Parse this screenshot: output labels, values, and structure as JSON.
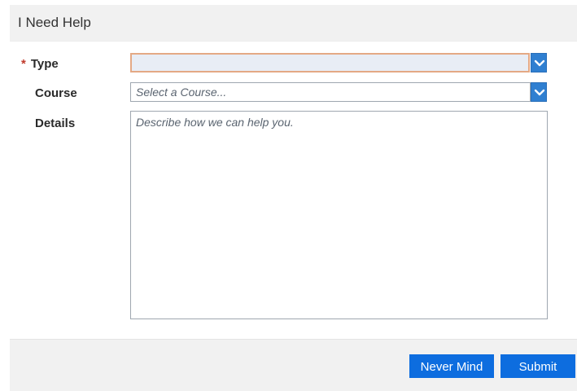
{
  "dialog": {
    "title": "I Need Help"
  },
  "form": {
    "type": {
      "required_mark": "*",
      "label": "Type",
      "value": ""
    },
    "course": {
      "label": "Course",
      "placeholder": "Select a Course..."
    },
    "details": {
      "label": "Details",
      "placeholder": "Describe how we can help you."
    }
  },
  "footer": {
    "never_mind_label": "Never Mind",
    "submit_label": "Submit"
  },
  "colors": {
    "button_blue": "#0d6ddf",
    "dropdown_blue": "#2f7fd1",
    "required_red": "#c0392b",
    "focus_border": "#e4a985"
  },
  "icons": {
    "dropdown": "chevron-down-icon"
  }
}
